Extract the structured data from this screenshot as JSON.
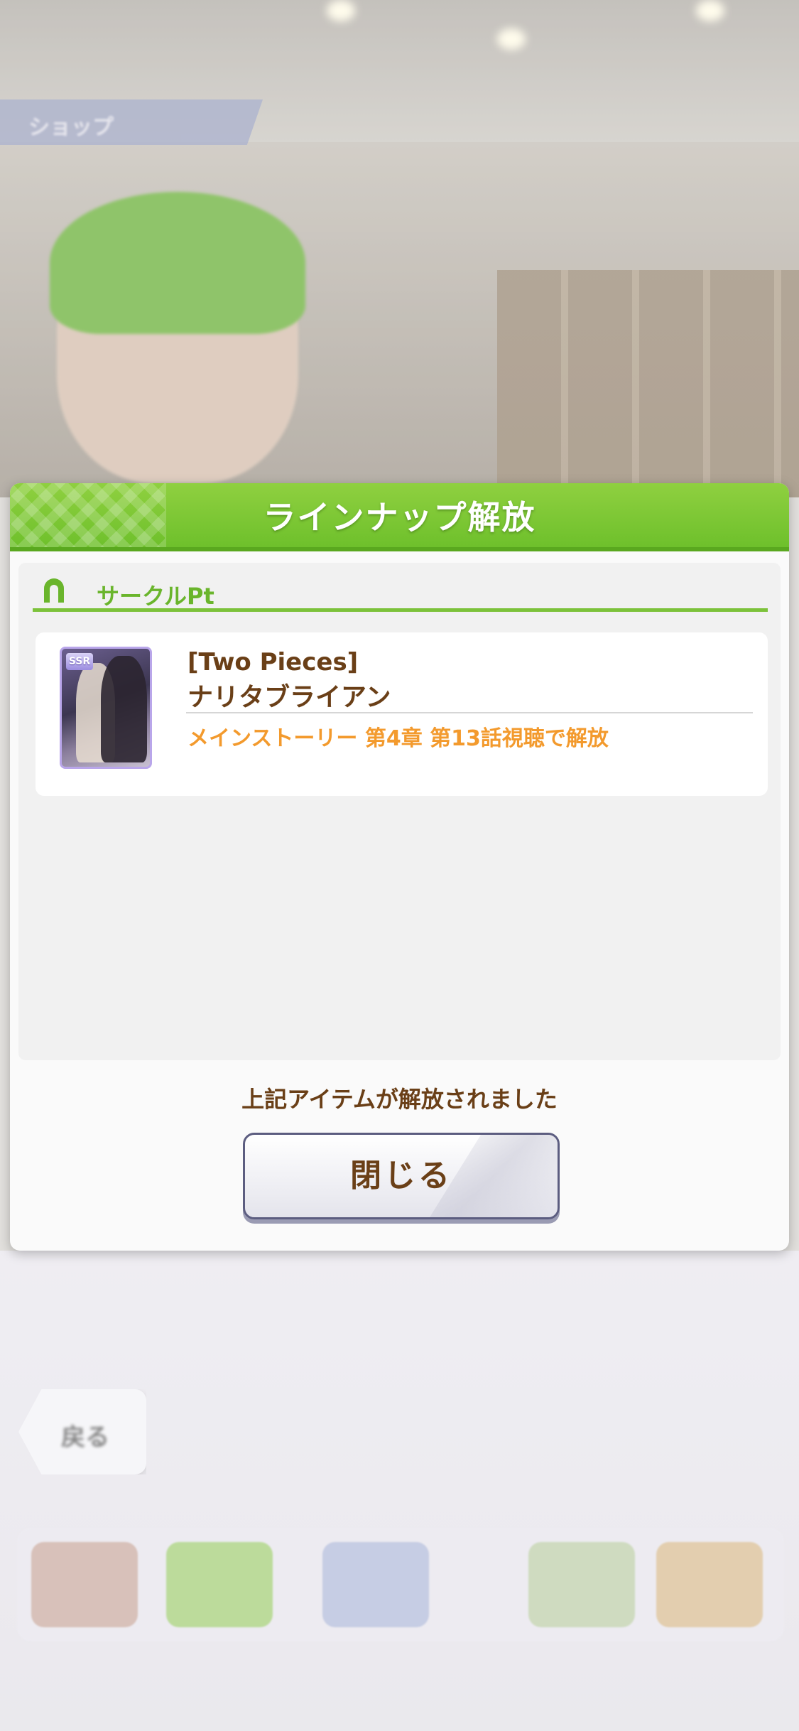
{
  "background": {
    "shop_tab_label": "ショップ",
    "back_label": "戻る"
  },
  "dialog": {
    "title": "ラインナップ解放",
    "section_label": "サークルPt",
    "item": {
      "rarity": "SSR",
      "subtitle": "[Two Pieces]",
      "name": "ナリタブライアン",
      "unlock_condition": "メインストーリー 第4章 第13話視聴で解放"
    },
    "notice": "上記アイテムが解放されました",
    "close_label": "閉じる"
  },
  "colors": {
    "header_green": "#7cc23a",
    "text_brown": "#6a3f17",
    "condition_orange": "#f39a2d",
    "ssr_purple": "#b9a6ea"
  },
  "icons": {
    "section_icon": "horseshoe-icon"
  }
}
